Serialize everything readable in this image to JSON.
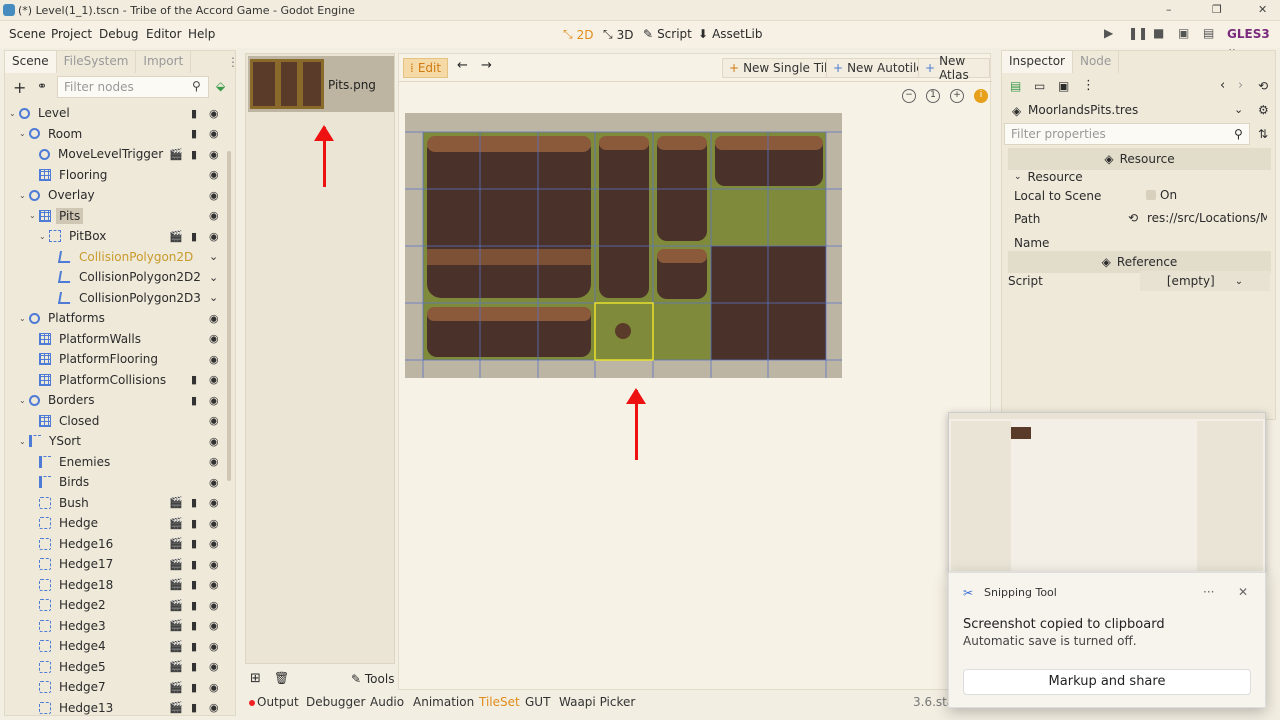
{
  "window": {
    "title": "(*) Level(1_1).tscn - Tribe of the Accord Game - Godot Engine",
    "minimize": "–",
    "maximize": "❐",
    "close": "✕"
  },
  "menu": [
    "Scene",
    "Project",
    "Debug",
    "Editor",
    "Help"
  ],
  "workspaces": {
    "w2d": "2D",
    "w3d": "3D",
    "script": "Script",
    "assetlib": "AssetLib"
  },
  "renderer": "GLES3",
  "scene_dock": {
    "tabs": [
      "Scene",
      "FileSystem",
      "Import"
    ],
    "filter_placeholder": "Filter nodes",
    "nodes": [
      {
        "label": "Level",
        "icon": "circ",
        "depth": 0,
        "arrow": true,
        "right": "film-eye"
      },
      {
        "label": "Room",
        "icon": "circ",
        "depth": 1,
        "arrow": true,
        "right": "film-eye"
      },
      {
        "label": "MoveLevelTrigger",
        "icon": "circ",
        "depth": 2,
        "right": "clap-film-eye"
      },
      {
        "label": "Flooring",
        "icon": "grid",
        "depth": 2,
        "right": "eye"
      },
      {
        "label": "Overlay",
        "icon": "circ",
        "depth": 1,
        "arrow": true,
        "right": "eye"
      },
      {
        "label": "Pits",
        "icon": "grid",
        "depth": 2,
        "arrow": true,
        "sel": true,
        "right": "eye"
      },
      {
        "label": "PitBox",
        "icon": "box",
        "depth": 3,
        "arrow": true,
        "right": "clap-film-eye"
      },
      {
        "label": "CollisionPolygon2D",
        "icon": "kite",
        "depth": 4,
        "yellow": true,
        "right": "chev"
      },
      {
        "label": "CollisionPolygon2D2",
        "icon": "kite",
        "depth": 4,
        "right": "chev"
      },
      {
        "label": "CollisionPolygon2D3",
        "icon": "kite",
        "depth": 4,
        "right": "chev"
      },
      {
        "label": "Platforms",
        "icon": "circ",
        "depth": 1,
        "arrow": true,
        "right": "eye"
      },
      {
        "label": "PlatformWalls",
        "icon": "grid",
        "depth": 2,
        "right": "eye"
      },
      {
        "label": "PlatformFlooring",
        "icon": "grid",
        "depth": 2,
        "right": "eye"
      },
      {
        "label": "PlatformCollisions",
        "icon": "grid",
        "depth": 2,
        "right": "film-eye"
      },
      {
        "label": "Borders",
        "icon": "circ",
        "depth": 1,
        "arrow": true,
        "right": "film-eye"
      },
      {
        "label": "Closed",
        "icon": "grid",
        "depth": 2,
        "right": "eye"
      },
      {
        "label": "YSort",
        "icon": "sort",
        "depth": 1,
        "arrow": true,
        "right": "eye"
      },
      {
        "label": "Enemies",
        "icon": "sort",
        "depth": 2,
        "right": "eye"
      },
      {
        "label": "Birds",
        "icon": "sort",
        "depth": 2,
        "right": "eye"
      },
      {
        "label": "Bush",
        "icon": "dotsq",
        "depth": 2,
        "right": "clap-film-eye"
      },
      {
        "label": "Hedge",
        "icon": "dotsq",
        "depth": 2,
        "right": "clap-film-eye"
      },
      {
        "label": "Hedge16",
        "icon": "dotsq",
        "depth": 2,
        "right": "clap-film-eye"
      },
      {
        "label": "Hedge17",
        "icon": "dotsq",
        "depth": 2,
        "right": "clap-film-eye"
      },
      {
        "label": "Hedge18",
        "icon": "dotsq",
        "depth": 2,
        "right": "clap-film-eye"
      },
      {
        "label": "Hedge2",
        "icon": "dotsq",
        "depth": 2,
        "right": "clap-film-eye"
      },
      {
        "label": "Hedge3",
        "icon": "dotsq",
        "depth": 2,
        "right": "clap-film-eye"
      },
      {
        "label": "Hedge4",
        "icon": "dotsq",
        "depth": 2,
        "right": "clap-film-eye"
      },
      {
        "label": "Hedge5",
        "icon": "dotsq",
        "depth": 2,
        "right": "clap-film-eye"
      },
      {
        "label": "Hedge7",
        "icon": "dotsq",
        "depth": 2,
        "right": "clap-film-eye"
      },
      {
        "label": "Hedge13",
        "icon": "dotsq",
        "depth": 2,
        "right": "clap-film-eye"
      }
    ]
  },
  "tileset_list": {
    "item": "Pits.png",
    "tools": "Tools"
  },
  "editor": {
    "edit": "Edit",
    "new_single": "New Single Tile",
    "new_autotile": "New Autotile",
    "new_atlas": "New Atlas",
    "zoom_reset": "1",
    "info": "i"
  },
  "inspector": {
    "tabs": [
      "Inspector",
      "Node"
    ],
    "resource_file": "MoorlandsPits.tres",
    "filter_placeholder": "Filter properties",
    "section_resource": "Resource",
    "group_resource": "Resource",
    "local_to_scene": "Local to Scene",
    "local_on": "On",
    "path_label": "Path",
    "path_value": "res://src/Locations/Mo",
    "name_label": "Name",
    "section_reference": "Reference",
    "script_label": "Script",
    "script_value": "[empty]"
  },
  "bottom": {
    "tabs": [
      "Output",
      "Debugger",
      "Audio",
      "Animation",
      "TileSet",
      "GUT",
      "Waapi Picker"
    ],
    "version": "3.6.sta"
  },
  "toast": {
    "app": "Snipping Tool",
    "more": "···",
    "close": "✕",
    "title": "Screenshot copied to clipboard",
    "body": "Automatic save is turned off.",
    "button": "Markup and share"
  },
  "colors": {
    "accent": "#e08c1b",
    "dirt": "#4a3129",
    "grass": "#7f8a3a",
    "arrow": "#e11111"
  }
}
